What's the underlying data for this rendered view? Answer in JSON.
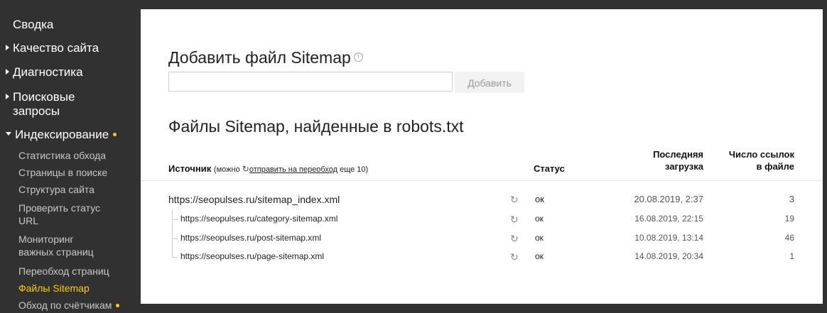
{
  "sidebar": {
    "items": [
      {
        "label": "Сводка"
      },
      {
        "label": "Качество сайта"
      },
      {
        "label": "Диагностика"
      },
      {
        "label": "Поисковые"
      },
      {
        "label": "запросы"
      },
      {
        "label": "Индексирование"
      }
    ],
    "subitems": [
      {
        "label": "Статистика обхода"
      },
      {
        "label": "Страницы в поиске"
      },
      {
        "label": "Структура сайта"
      },
      {
        "label": "Проверить статус"
      },
      {
        "label": "URL"
      },
      {
        "label": "Мониторинг"
      },
      {
        "label": "важных страниц"
      },
      {
        "label": "Переобход страниц"
      },
      {
        "label": "Файлы Sitemap"
      },
      {
        "label": "Обход по счётчикам"
      }
    ]
  },
  "main": {
    "add_title": "Добавить файл Sitemap",
    "info_glyph": "i",
    "input_value": "",
    "add_button": "Добавить",
    "found_title": "Файлы Sitemap, найденные в robots.txt",
    "table": {
      "header_source": "Источник",
      "header_note_prefix": "(можно",
      "header_note_icon": "↻",
      "header_note_link": "отправить на переобход",
      "header_note_suffix": "еще 10)",
      "header_status": "Статус",
      "header_last_1": "Последняя",
      "header_last_2": "загрузка",
      "header_links_1": "Число ссылок",
      "header_links_2": "в файле",
      "rows": [
        {
          "url": "https://seopulses.ru/sitemap_index.xml",
          "status": "ок",
          "date": "20.08.2019, 2:37",
          "count": "3"
        },
        {
          "url": "https://seopulses.ru/category-sitemap.xml",
          "status": "ок",
          "date": "16.08.2019, 22:15",
          "count": "19"
        },
        {
          "url": "https://seopulses.ru/post-sitemap.xml",
          "status": "ок",
          "date": "10.08.2019, 13:14",
          "count": "46"
        },
        {
          "url": "https://seopulses.ru/page-sitemap.xml",
          "status": "ок",
          "date": "14.08.2019, 20:34",
          "count": "1"
        }
      ],
      "refresh_glyph": "↻"
    }
  },
  "colors": {
    "sidebar_bg": "#313131",
    "accent": "#ffcc00",
    "panel_bg": "#ffffff"
  }
}
